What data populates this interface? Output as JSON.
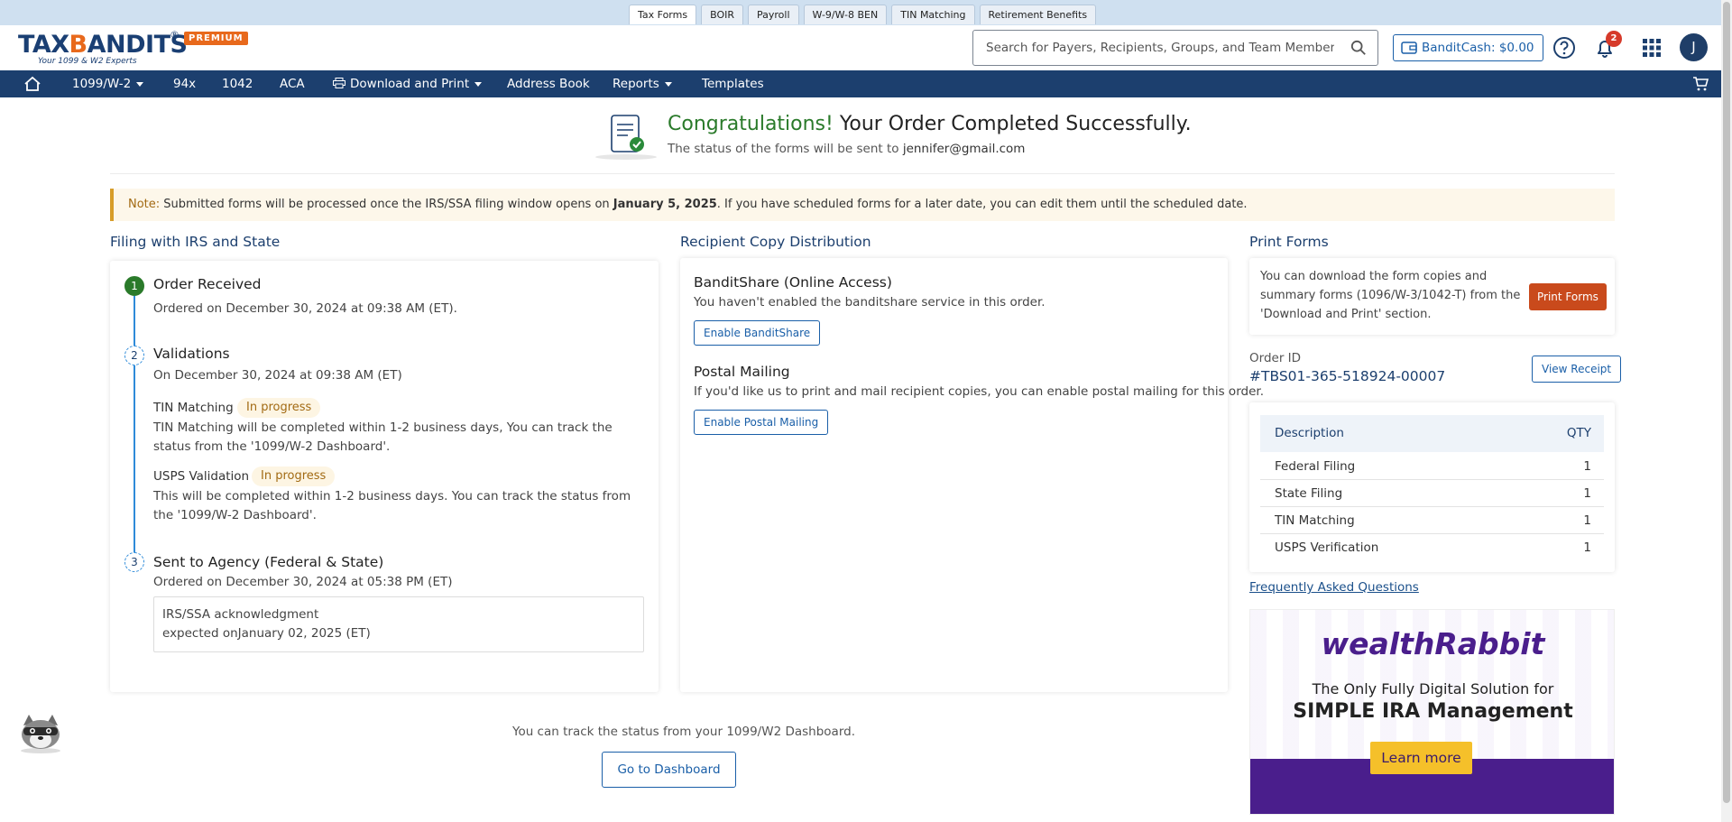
{
  "product_tabs": [
    "Tax Forms",
    "BOIR",
    "Payroll",
    "W-9/W-8 BEN",
    "TIN Matching",
    "Retirement Benefits"
  ],
  "logo": {
    "brand": "TAXBANDITS",
    "tagline": "Your 1099 & W2 Experts",
    "registered": "®",
    "premium_badge": "PREMIUM"
  },
  "header": {
    "search_placeholder": "Search for Payers, Recipients, Groups, and Team Members",
    "banditcash_label": "BanditCash:",
    "banditcash_value": "$0.00",
    "notification_count": "2",
    "avatar_initial": "J",
    "icons": [
      "search-icon",
      "wallet-icon",
      "help-icon",
      "bell-icon",
      "apps-grid-icon"
    ]
  },
  "nav": {
    "items": [
      "1099/W-2",
      "94x",
      "1042",
      "ACA",
      "Download and Print",
      "Address Book",
      "Reports",
      "Templates"
    ],
    "icons": [
      "home-icon",
      "printer-icon",
      "cart-icon"
    ]
  },
  "hero": {
    "congrats": "Congratulations!",
    "title_rest": " Your Order Completed Successfully.",
    "sub_prefix": "The status of the forms will be sent to ",
    "email": "jennifer@gmail.com"
  },
  "note": {
    "label": "Note:",
    "text_before": " Submitted forms will be processed once the IRS/SSA filing window opens on ",
    "date": "January 5, 2025",
    "text_after": ". If you have scheduled forms for a later date, you can edit them until the scheduled date."
  },
  "filing": {
    "section_title": "Filing with IRS and State",
    "steps": [
      {
        "num": "1",
        "title": "Order Received",
        "text": "Ordered on December 30, 2024 at 09:38 AM (ET)."
      },
      {
        "num": "2",
        "title": "Validations",
        "text": "On December 30, 2024 at 09:38 AM (ET)"
      },
      {
        "num": "3",
        "title": "Sent to Agency (Federal & State)",
        "text": "Ordered on December 30, 2024 at 05:38 PM (ET)"
      }
    ],
    "tin_label": "TIN Matching",
    "tin_status": "In progress",
    "tin_text": "TIN Matching will be completed within 1-2 business days, You can track the status from the '1099/W-2 Dashboard'.",
    "usps_label": "USPS Validation",
    "usps_status": "In progress",
    "usps_text": "This will be completed within 1-2 business days. You can track the status from the '1099/W-2 Dashboard'.",
    "ack_line1": "IRS/SSA acknowledgment",
    "ack_line2": "expected onJanuary 02, 2025 (ET)"
  },
  "recipient": {
    "section_title": "Recipient Copy Distribution",
    "banditshare_title": "BanditShare (Online Access)",
    "banditshare_text": "You haven't enabled the banditshare service in this order.",
    "banditshare_button": "Enable BanditShare",
    "postal_title": "Postal Mailing",
    "postal_text": "If you'd like us to print and mail recipient copies, you can enable postal mailing for this order.",
    "postal_button": "Enable Postal Mailing"
  },
  "print_forms": {
    "section_title": "Print Forms",
    "text": "You can download the form copies and summary forms (1096/W-3/1042-T) from the 'Download and Print' section.",
    "button": "Print Forms"
  },
  "order": {
    "id_label": "Order ID",
    "id_value": "#TBS01-365-518924-00007",
    "receipt_button": "View Receipt",
    "table_headers": [
      "Description",
      "QTY"
    ],
    "rows": [
      {
        "desc": "Federal Filing",
        "qty": "1"
      },
      {
        "desc": "State Filing",
        "qty": "1"
      },
      {
        "desc": "TIN Matching",
        "qty": "1"
      },
      {
        "desc": "USPS Verification",
        "qty": "1"
      }
    ]
  },
  "faq_link": "Frequently Asked Questions",
  "ad": {
    "brand": "wealthRabbit",
    "line1": "The Only Fully Digital Solution for",
    "line2": "SIMPLE IRA Management",
    "button": "Learn more"
  },
  "footer": {
    "track_text": "You can track the status from your 1099/W2 Dashboard.",
    "dashboard_button": "Go to Dashboard"
  },
  "colors": {
    "nav_bg": "#1c3f6e",
    "accent_orange": "#e8691c",
    "success_green": "#2a7a2a",
    "link_blue": "#1a5fa8",
    "print_button": "#c94a1c",
    "ad_purple": "#4a1e8c"
  }
}
